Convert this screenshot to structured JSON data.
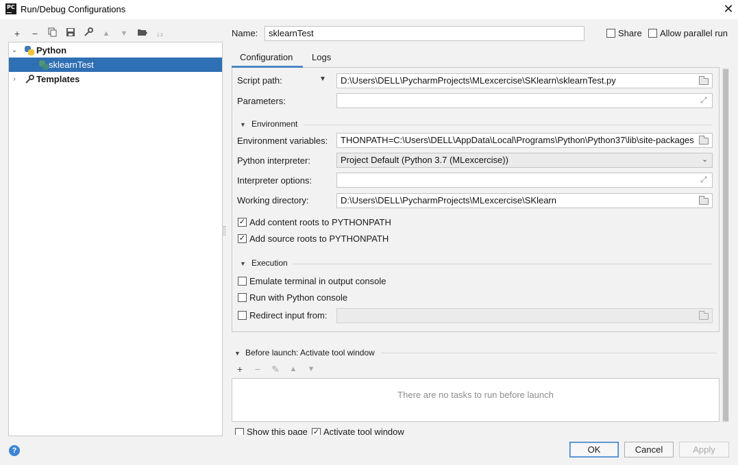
{
  "window": {
    "title": "Run/Debug Configurations",
    "app_icon_text": "PC"
  },
  "toolbar": [
    "add-icon",
    "remove-icon",
    "copy-icon",
    "save-icon",
    "wrench-icon",
    "move-up-icon",
    "move-down-icon",
    "folder-add-icon",
    "sort-icon"
  ],
  "tree": {
    "python_label": "Python",
    "child_label": "sklearnTest",
    "templates_label": "Templates"
  },
  "header": {
    "name_label": "Name:",
    "name_value": "sklearnTest",
    "share_label": "Share",
    "parallel_label": "Allow parallel run"
  },
  "tabs": {
    "configuration": "Configuration",
    "logs": "Logs"
  },
  "form": {
    "script_path_label": "Script path:",
    "script_path_value": "D:\\Users\\DELL\\PycharmProjects\\MLexcercise\\SKlearn\\sklearnTest.py",
    "parameters_label": "Parameters:",
    "parameters_value": "",
    "environment_label": "Environment",
    "env_vars_label": "Environment variables:",
    "env_vars_value": "THONPATH=C:\\Users\\DELL\\AppData\\Local\\Programs\\Python\\Python37\\lib\\site-packages",
    "interpreter_label": "Python interpreter:",
    "interpreter_value": "Project Default (Python 3.7 (MLexcercise))",
    "interp_options_label": "Interpreter options:",
    "interp_options_value": "",
    "working_dir_label": "Working directory:",
    "working_dir_value": "D:\\Users\\DELL\\PycharmProjects\\MLexcercise\\SKlearn",
    "content_roots_label": "Add content roots to PYTHONPATH",
    "source_roots_label": "Add source roots to PYTHONPATH",
    "execution_label": "Execution",
    "emulate_terminal_label": "Emulate terminal in output console",
    "python_console_label": "Run with Python console",
    "redirect_input_label": "Redirect input from:"
  },
  "before_launch": {
    "title": "Before launch: Activate tool window",
    "empty_text": "There are no tasks to run before launch",
    "show_page_label": "Show this page",
    "activate_tool_label": "Activate tool window"
  },
  "buttons": {
    "ok": "OK",
    "cancel": "Cancel",
    "apply": "Apply",
    "help": "?"
  },
  "colors": {
    "selection": "#2f6fb3",
    "accent": "#4a86c7"
  }
}
